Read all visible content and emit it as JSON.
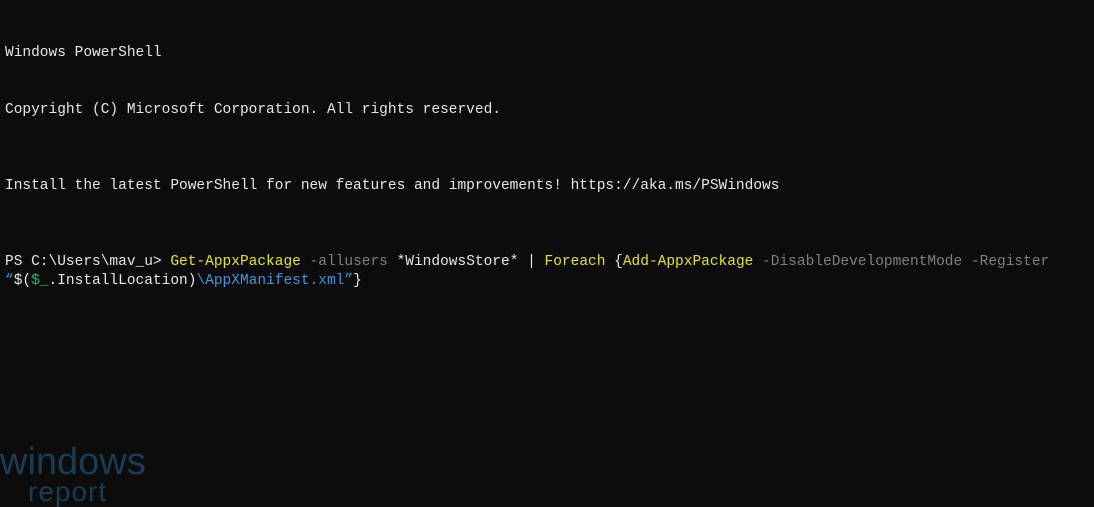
{
  "header": {
    "line1": "Windows PowerShell",
    "line2": "Copyright (C) Microsoft Corporation. All rights reserved.",
    "install_msg": "Install the latest PowerShell for new features and improvements! https://aka.ms/PSWindows"
  },
  "prompt": {
    "ps": "PS C:\\Users\\mav_u> ",
    "cmd": {
      "get_appx": "Get-AppxPackage",
      "allusers": " -allusers",
      "winstore": " *WindowsStore* | ",
      "foreach": "Foreach",
      "brace_open": " {",
      "add_appx": "Add-AppxPackage",
      "flags": " -DisableDevelopmentMode -Register ",
      "quote_open": "“",
      "dollar_paren": "$(",
      "underscore_var": "$_",
      "dot_install": ".InstallLocation",
      "paren_close": ")",
      "manifest": "\\AppXManifest.xml”",
      "brace_close": "}"
    }
  },
  "watermark": {
    "top": "windows",
    "bottom": "report"
  }
}
